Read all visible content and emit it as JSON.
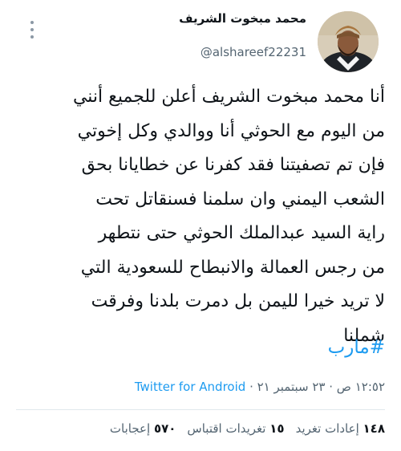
{
  "author": {
    "name": "محمد مبخوت الشريف",
    "handle": "@alshareef22231"
  },
  "tweet": {
    "lines": [
      "أنا محمد مبخوت الشريف أعلن للجميع أنني",
      "من اليوم مع الحوثي أنا ووالدي وكل إخوتي",
      "فإن تم تصفيتنا فقد كفرنا عن خطايانا بحق",
      "الشعب اليمني وان سلمنا فسنقاتل تحت",
      "راية السيد عبدالملك الحوثي حتى نتطهر",
      "من رجس العمالة والانبطاح للسعودية التي",
      "لا تريد خيرا لليمن بل دمرت بلدنا وفرقت",
      "شملنا"
    ],
    "hashtag": "#مارب"
  },
  "meta": {
    "timestamp": "١٢:٥٢ ص · ٢٣ سبتمبر ٢١ ·",
    "source": "Twitter for Android"
  },
  "stats": {
    "retweets_count": "١٤٨",
    "retweets_label": "إعادات تغريد",
    "quotes_count": "١٥",
    "quotes_label": "تغريدات اقتباس",
    "likes_count": "٥٧٠",
    "likes_label": "إعجابات"
  },
  "colors": {
    "accent": "#1d9bf0",
    "secondary_text": "#536471"
  }
}
